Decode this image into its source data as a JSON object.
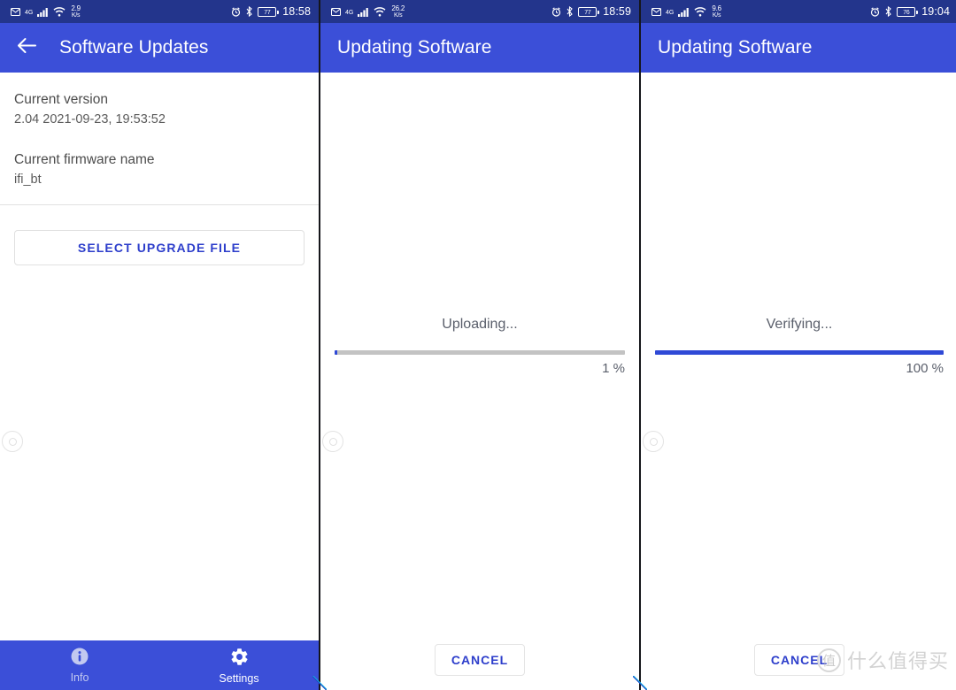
{
  "panels": [
    {
      "status_bar": {
        "mail_icon": "mail-icon",
        "network_type": "4G",
        "signal_icon": "signal-bars-icon",
        "wifi_icon": "wifi-icon",
        "data_rate": "2.9",
        "data_rate_unit": "K/s",
        "alarm_icon": "alarm-clock-icon",
        "bluetooth_icon": "bluetooth-icon",
        "battery_level": "77",
        "time": "18:58"
      },
      "app_bar": {
        "back_icon": "back-arrow-icon",
        "title": "Software Updates",
        "has_back": true
      },
      "content": {
        "groups": [
          {
            "label": "Current version",
            "value": "2.04  2021-09-23, 19:53:52"
          },
          {
            "label": "Current firmware name",
            "value": "ifi_bt"
          }
        ],
        "upgrade_button": "SELECT UPGRADE FILE"
      },
      "bottom_nav": [
        {
          "icon": "info-icon",
          "label": "Info",
          "active": false
        },
        {
          "icon": "gear-icon",
          "label": "Settings",
          "active": true
        }
      ]
    },
    {
      "status_bar": {
        "mail_icon": "mail-icon",
        "network_type": "4G",
        "signal_icon": "signal-bars-icon",
        "wifi_icon": "wifi-icon",
        "data_rate": "26.2",
        "data_rate_unit": "K/s",
        "alarm_icon": "alarm-clock-icon",
        "bluetooth_icon": "bluetooth-icon",
        "battery_level": "77",
        "time": "18:59"
      },
      "app_bar": {
        "title": "Updating Software",
        "has_back": false
      },
      "progress": {
        "status_text": "Uploading...",
        "percent_label": "1 %",
        "percent_value": 1,
        "fill_color": "#2f49d6",
        "track_color": "#c3c3c3"
      },
      "cancel_button": "CANCEL"
    },
    {
      "status_bar": {
        "mail_icon": "mail-icon",
        "network_type": "4G",
        "signal_icon": "signal-bars-icon",
        "wifi_icon": "wifi-icon",
        "data_rate": "9.6",
        "data_rate_unit": "K/s",
        "alarm_icon": "alarm-clock-icon",
        "bluetooth_icon": "bluetooth-icon",
        "battery_level": "76",
        "time": "19:04"
      },
      "app_bar": {
        "title": "Updating Software",
        "has_back": false
      },
      "progress": {
        "status_text": "Verifying...",
        "percent_label": "100 %",
        "percent_value": 100,
        "fill_color": "#2f49d6",
        "track_color": "#c3c3c3"
      },
      "cancel_button": "CANCEL"
    }
  ],
  "watermark": {
    "logo_glyph": "值",
    "text": "什么值得买"
  },
  "colors": {
    "status_bar": "#23358c",
    "app_bar": "#3b4fd8",
    "accent_blue": "#2d3ecb",
    "progress_fill": "#2f49d6"
  }
}
